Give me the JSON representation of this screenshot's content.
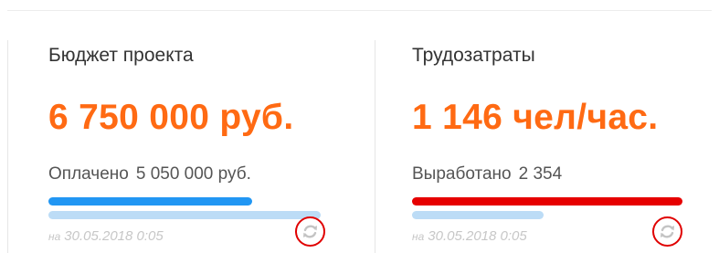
{
  "cards": [
    {
      "title": "Бюджет проекта",
      "value": "6 750 000 руб.",
      "sub_label": "Оплачено",
      "sub_value": "5 050 000 руб.",
      "bar_primary_fraction": 0.748,
      "bar_secondary_fraction": 1.0,
      "bar_primary_color": "#2196f3",
      "date_prefix": "на",
      "date": "30.05.2018 0:05",
      "refresh_icon": "refresh-icon"
    },
    {
      "title": "Трудозатраты",
      "value": "1 146 чел/час.",
      "sub_label": "Выработано",
      "sub_value": "2 354",
      "bar_primary_fraction": 1.0,
      "bar_secondary_fraction": 0.487,
      "bar_primary_color": "#e60000",
      "date_prefix": "на",
      "date": "30.05.2018 0:05",
      "refresh_icon": "refresh-icon"
    }
  ],
  "colors": {
    "accent": "#ff6a13",
    "highlight_circle": "#e00000",
    "secondary_bar": "#bcdcf6"
  }
}
